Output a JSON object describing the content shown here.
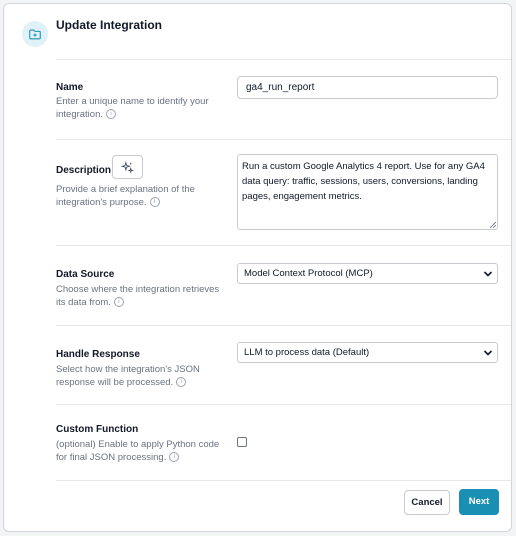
{
  "header": {
    "title": "Update Integration",
    "icon": "folder-plus-icon"
  },
  "fields": {
    "name": {
      "label": "Name",
      "help": "Enter a unique name to identify your integration.",
      "value": "ga4_run_report"
    },
    "description": {
      "label": "Description",
      "help": "Provide a brief explanation of the integration's purpose.",
      "value": "Run a custom Google Analytics 4 report. Use for any GA4 data query: traffic, sessions, users, conversions, landing pages, engagement metrics."
    },
    "data_source": {
      "label": "Data Source",
      "help": "Choose where the integration retrieves its data from.",
      "value": "Model Context Protocol (MCP)"
    },
    "handle_response": {
      "label": "Handle Response",
      "help": "Select how the integration's JSON response will be processed.",
      "value": "LLM to process data (Default)"
    },
    "custom_function": {
      "label": "Custom Function",
      "help": "(optional) Enable to apply Python code for final JSON processing.",
      "checked": false
    }
  },
  "footer": {
    "cancel_label": "Cancel",
    "next_label": "Next"
  },
  "colors": {
    "accent": "#1a8fb4",
    "icon_bg": "#e0f2f7"
  }
}
